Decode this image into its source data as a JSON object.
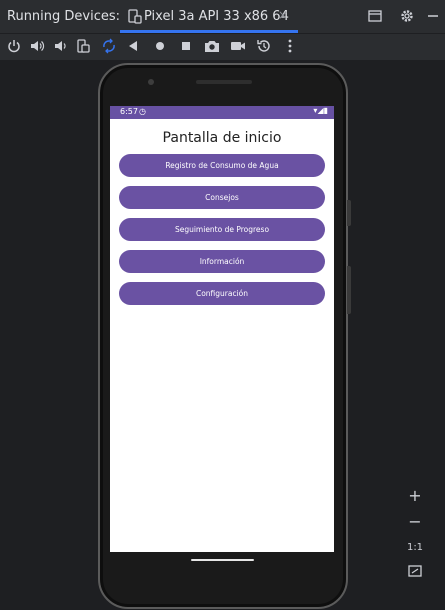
{
  "header": {
    "title": "Running Devices:",
    "tab_label": "Pixel 3a API 33 x86 64",
    "tab_close": "×",
    "icons": [
      "device-icon",
      "window-restore-icon",
      "gear-icon",
      "minimize-icon"
    ]
  },
  "toolbar": {
    "icons": [
      "power-icon",
      "volume-up-icon",
      "volume-down-icon",
      "rotate-left-icon",
      "rotate-right-icon",
      "back-icon",
      "home-icon",
      "overview-icon",
      "screenshot-icon",
      "screen-record-icon",
      "snapshot-icon",
      "more-icon"
    ]
  },
  "emulator": {
    "status_time": "6:57",
    "status_icons": "▾◢▮",
    "sync_icon": "◷",
    "app_title": "Pantalla de inicio",
    "buttons": [
      "Registro de Consumo de Agua",
      "Consejos",
      "Seguimiento de Progreso",
      "Información",
      "Configuración"
    ]
  },
  "zoom": {
    "zoom_in": "+",
    "zoom_out": "−",
    "one_to_one": "1:1"
  },
  "colors": {
    "app_purple": "#6a52a3",
    "status_purple": "#6751a3",
    "accent_blue": "#3574f0"
  }
}
